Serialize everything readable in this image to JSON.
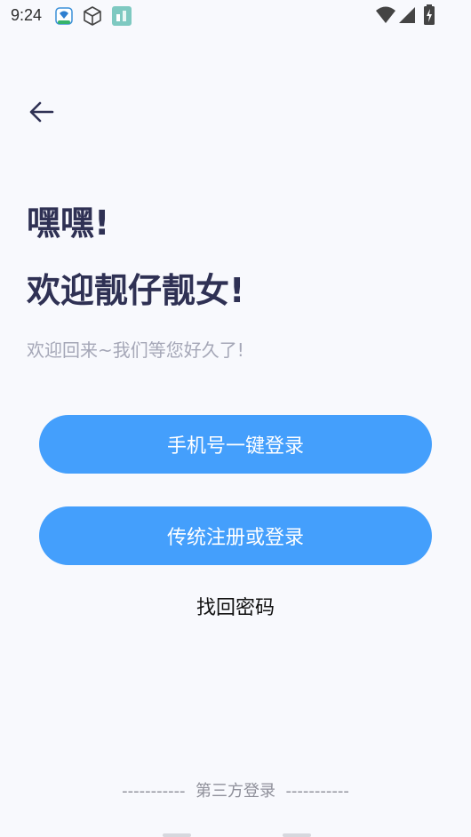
{
  "status_bar": {
    "time": "9:24",
    "icons": [
      "app-notification-icon",
      "package-icon",
      "app-store-icon",
      "wifi-icon",
      "signal-icon",
      "battery-charging-icon"
    ]
  },
  "nav": {
    "back_icon": "arrow-left-icon"
  },
  "header": {
    "greeting": "嘿嘿!",
    "welcome": "欢迎靓仔靓女!",
    "subtitle": "欢迎回来~我们等您好久了!"
  },
  "actions": {
    "phone_login_label": "手机号一键登录",
    "register_login_label": "传统注册或登录",
    "forgot_password_label": "找回密码"
  },
  "footer": {
    "third_party_label": "-----------  第三方登录  -----------"
  },
  "colors": {
    "background": "#f8f9fd",
    "primary_button": "#449ffc",
    "title_text": "#2f3154",
    "subtitle_text": "#a5a7b7"
  }
}
